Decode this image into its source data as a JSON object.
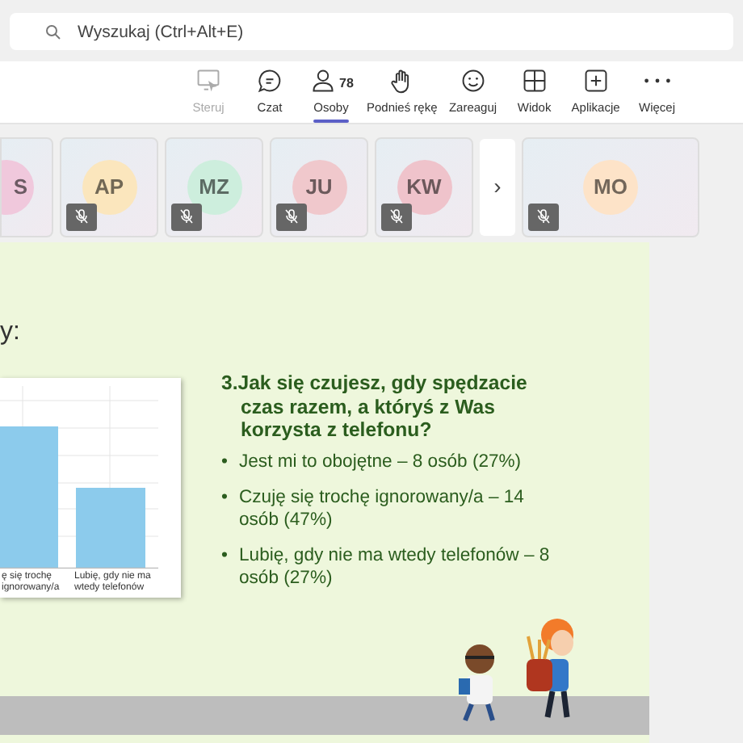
{
  "search": {
    "placeholder": "Wyszukaj (Ctrl+Alt+E)"
  },
  "toolbar": [
    {
      "kind": "share",
      "label": "Steruj",
      "disabled": true,
      "selected": false
    },
    {
      "kind": "chat",
      "label": "Czat",
      "disabled": false,
      "selected": false
    },
    {
      "kind": "people",
      "label": "Osoby",
      "count": "78",
      "disabled": false,
      "selected": true
    },
    {
      "kind": "hand",
      "label": "Podnieś rękę",
      "disabled": false,
      "selected": false
    },
    {
      "kind": "react",
      "label": "Zareaguj",
      "disabled": false,
      "selected": false
    },
    {
      "kind": "view",
      "label": "Widok",
      "disabled": false,
      "selected": false
    },
    {
      "kind": "apps",
      "label": "Aplikacje",
      "disabled": false,
      "selected": false
    },
    {
      "kind": "more",
      "label": "Więcej",
      "disabled": false,
      "selected": false
    }
  ],
  "participants": [
    {
      "initials": "S",
      "color": "#f0c8dc",
      "muted": false
    },
    {
      "initials": "AP",
      "color": "#fbe6bd",
      "muted": true
    },
    {
      "initials": "MZ",
      "color": "#cdeedd",
      "muted": true
    },
    {
      "initials": "JU",
      "color": "#f0c8cc",
      "muted": true
    },
    {
      "initials": "KW",
      "color": "#efc3cb",
      "muted": true
    }
  ],
  "next_button": "›",
  "pinned_participant": {
    "initials": "MO",
    "color": "#fde3c8",
    "muted": true
  },
  "slide": {
    "title_fragment": "y:",
    "chart_labels": [
      "ę się trochę ignorowany/a",
      "Lubię, gdy nie ma wtedy telefonów"
    ],
    "question": "3.Jak się czujesz, gdy spędzacie czas razem, a któryś z Was korzysta z telefonu?",
    "answers": [
      {
        "bullet": "•",
        "text": "Jest mi to obojętne – 8 osób (27%)"
      },
      {
        "bullet": "•",
        "text": "Czuję się trochę ignorowany/a – 14 osób (47%)"
      },
      {
        "bullet": "•",
        "text": "Lubię, gdy nie ma wtedy telefonów – 8 osób (27%)"
      }
    ]
  }
}
